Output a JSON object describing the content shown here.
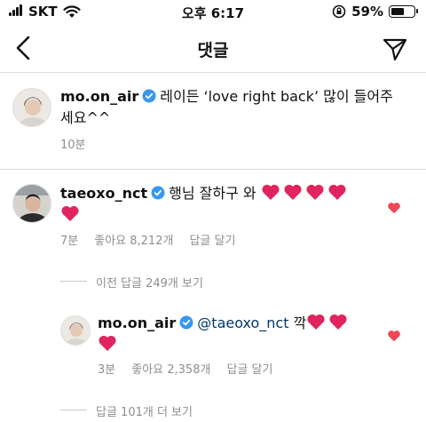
{
  "status_bar": {
    "carrier": "SKT",
    "time": "오후 6:17",
    "battery": "59%",
    "battery_level": 0.59
  },
  "header": {
    "title": "댓글"
  },
  "caption": {
    "username": "mo.on_air",
    "text_line1": "레이든 ‘love right back’ 많이 들어주",
    "text_line2": "세요^^",
    "time": "10분"
  },
  "comment": {
    "username": "taeoxo_nct",
    "text": "행님 잘하구 와",
    "hearts": 5,
    "time": "7분",
    "likes": "좋아요 8,212개",
    "reply": "답글 달기"
  },
  "view_prev": "이전 답글 249개 보기",
  "reply": {
    "username": "mo.on_air",
    "mention": "@taeoxo_nct",
    "text": "깍",
    "hearts": 3,
    "time": "3분",
    "likes": "좋아요 2,358개",
    "reply": "답글 달기"
  },
  "view_more": "답글 101개 더 보기",
  "colors": {
    "accent": "#3897f0",
    "heart": "#e0245e",
    "like": "#ed4956",
    "muted": "#8e8e8e"
  }
}
